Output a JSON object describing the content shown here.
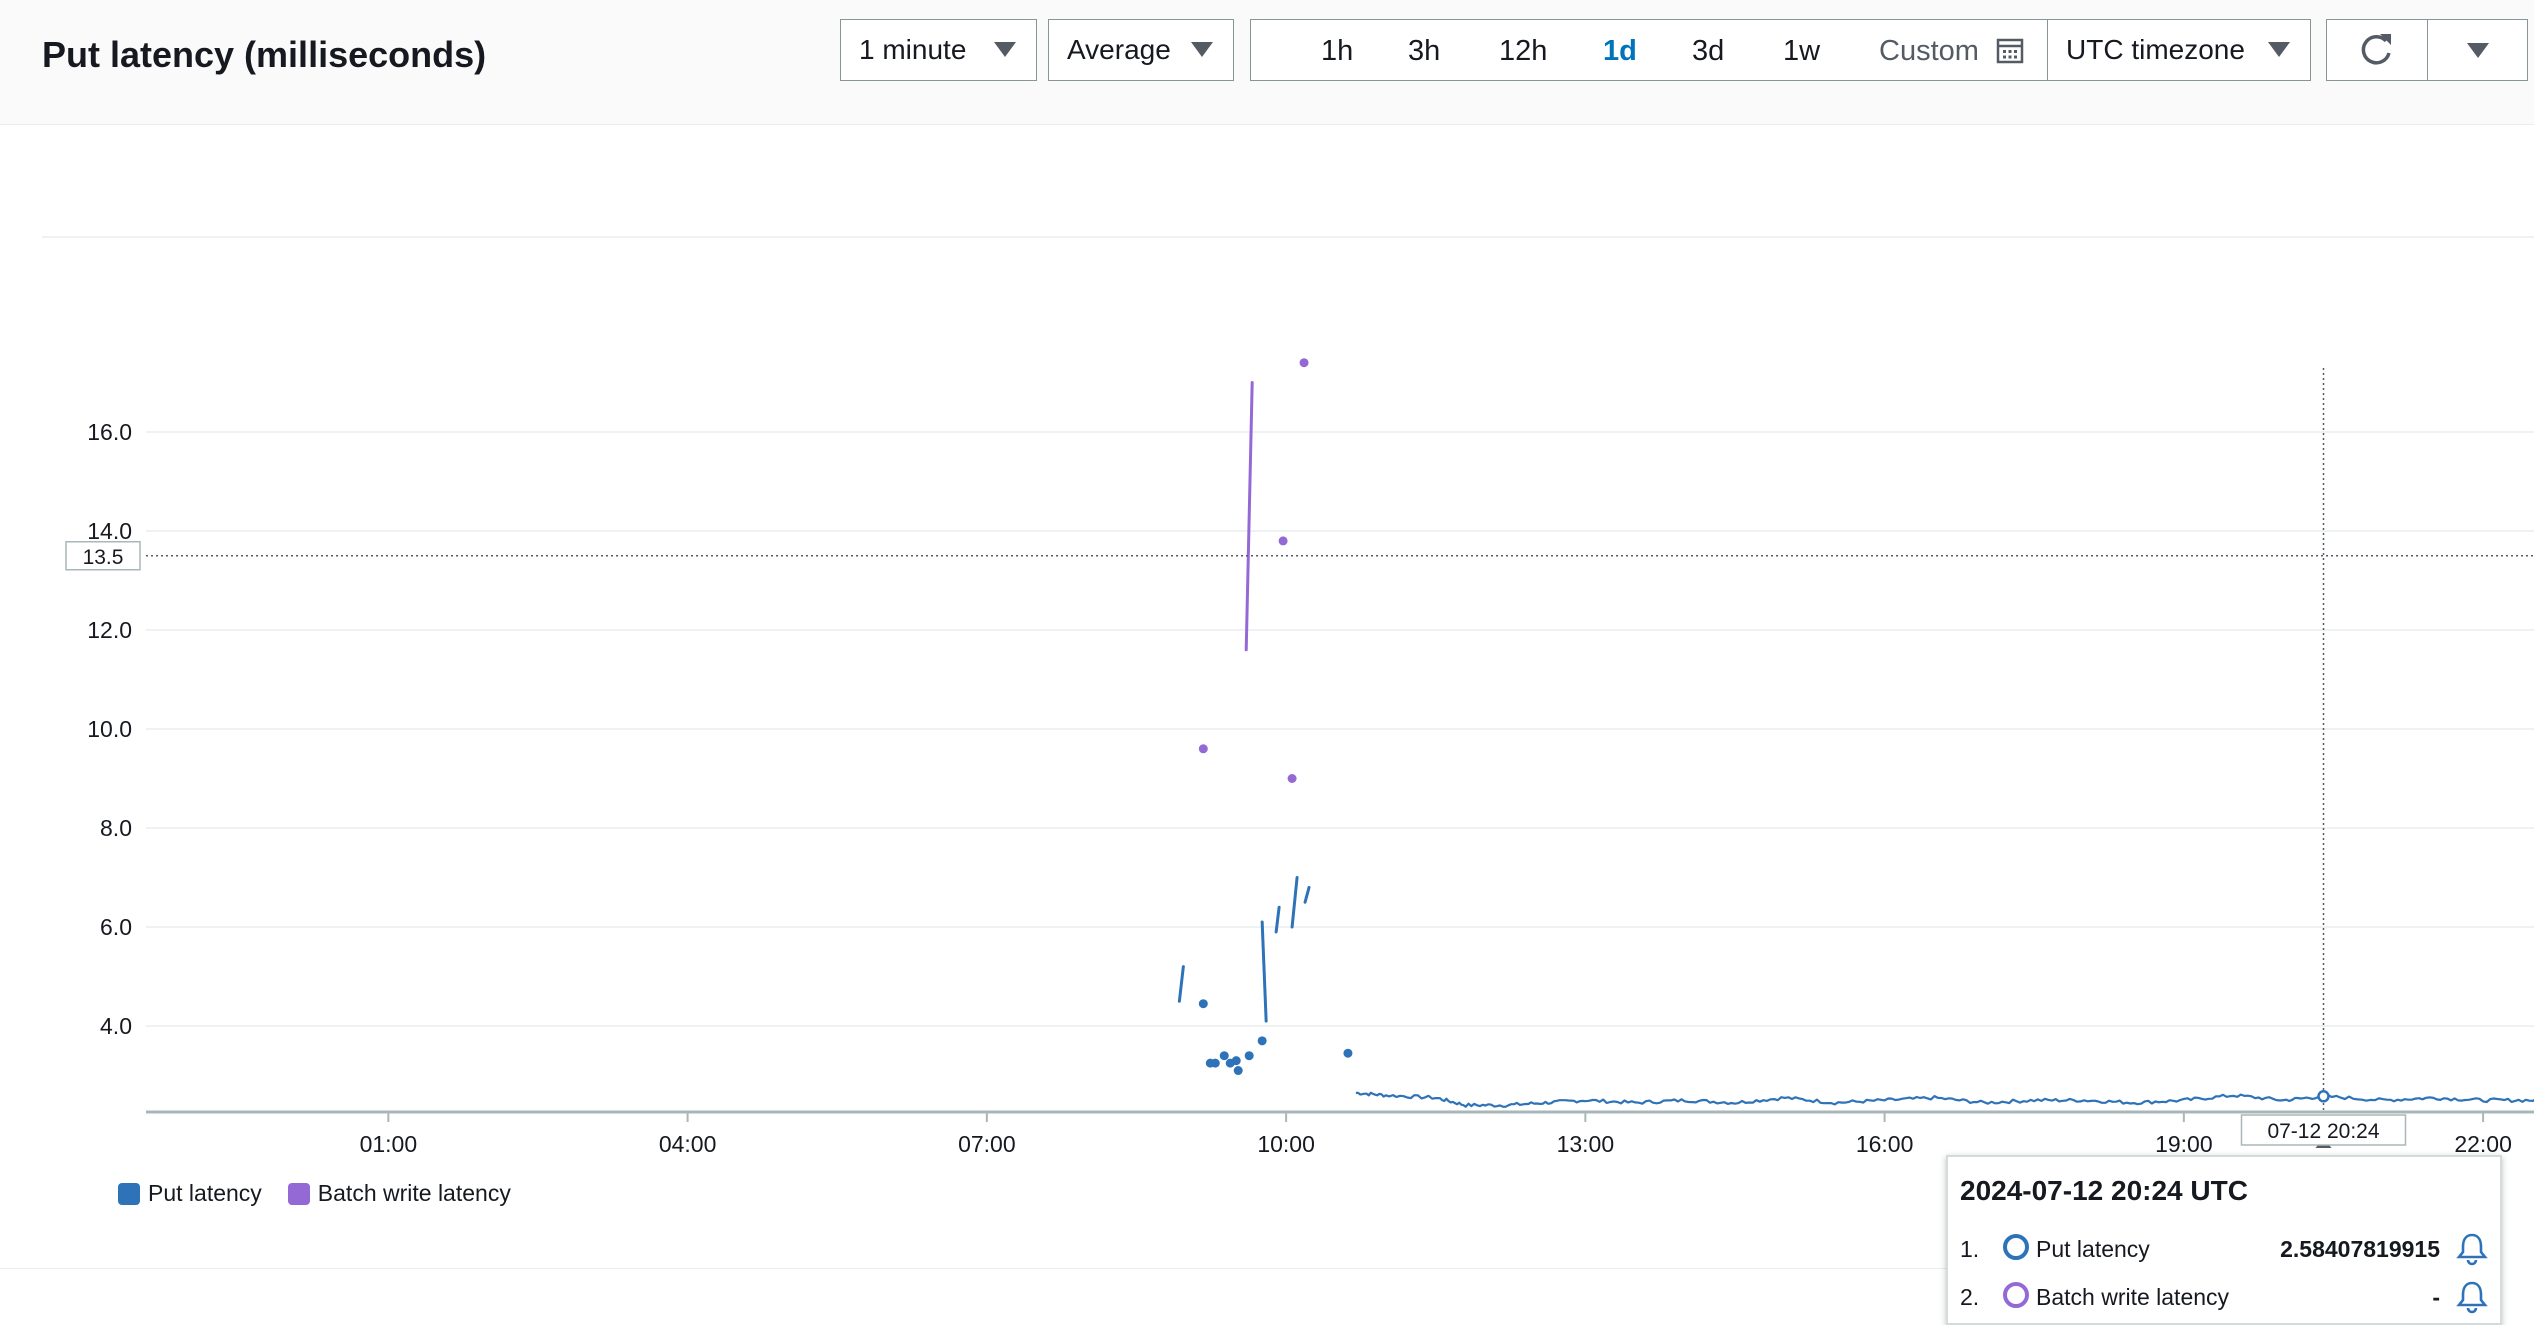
{
  "widget": {
    "title": "Put latency (milliseconds)"
  },
  "toolbar": {
    "period_label": "1 minute",
    "statistic_label": "Average",
    "ranges": [
      "1h",
      "3h",
      "12h",
      "1d",
      "3d",
      "1w"
    ],
    "active_range": "1d",
    "custom_label": "Custom",
    "timezone_label": "UTC timezone"
  },
  "colors": {
    "put_latency": "#2e73b8",
    "batch_write_latency": "#9469d6",
    "active_range": "#0073bb"
  },
  "chart_data": {
    "type": "line",
    "title": "Put latency (milliseconds)",
    "x_tick_labels": [
      "01:00",
      "04:00",
      "07:00",
      "10:00",
      "13:00",
      "16:00",
      "19:00",
      "22:00"
    ],
    "y_tick_labels": [
      "4.0",
      "6.0",
      "8.0",
      "10.0",
      "12.0",
      "14.0",
      "16.0"
    ],
    "x_range_hours": [
      -0.2,
      23.5
    ],
    "ylim": [
      2.35,
      17.5
    ],
    "grid": true,
    "legend_position": "bottom-left",
    "crosshair": {
      "x_label": "07-12 20:24",
      "y_label": "13.5",
      "x_hours": 20.4,
      "y": 13.5
    },
    "series": [
      {
        "name": "Put latency",
        "color": "#2e73b8",
        "segments": [
          [
            [
              8.93,
              4.5
            ],
            [
              8.97,
              5.2
            ]
          ],
          [
            [
              9.8,
              4.1
            ],
            [
              9.76,
              6.1
            ]
          ],
          [
            [
              9.9,
              5.9
            ],
            [
              9.93,
              6.4
            ]
          ],
          [
            [
              10.06,
              6.0
            ],
            [
              10.11,
              7.0
            ]
          ],
          [
            [
              10.19,
              6.5
            ],
            [
              10.23,
              6.8
            ]
          ]
        ],
        "points": [
          [
            9.17,
            4.45
          ],
          [
            9.24,
            3.25
          ],
          [
            9.29,
            3.25
          ],
          [
            9.38,
            3.4
          ],
          [
            9.44,
            3.25
          ],
          [
            9.5,
            3.3
          ],
          [
            9.52,
            3.1
          ],
          [
            9.63,
            3.4
          ],
          [
            9.76,
            3.7
          ],
          [
            10.62,
            3.45
          ]
        ],
        "line_start_hours": 10.7,
        "line_end_hours": 23.5,
        "line_samples": [
          [
            10.7,
            2.65
          ],
          [
            11.0,
            2.6
          ],
          [
            11.5,
            2.55
          ],
          [
            11.8,
            2.4
          ],
          [
            12.2,
            2.4
          ],
          [
            12.6,
            2.45
          ],
          [
            13.0,
            2.5
          ],
          [
            13.5,
            2.45
          ],
          [
            14.0,
            2.5
          ],
          [
            14.5,
            2.45
          ],
          [
            15.0,
            2.55
          ],
          [
            15.5,
            2.45
          ],
          [
            16.0,
            2.5
          ],
          [
            16.5,
            2.55
          ],
          [
            17.0,
            2.45
          ],
          [
            17.5,
            2.5
          ],
          [
            18.0,
            2.5
          ],
          [
            18.5,
            2.45
          ],
          [
            19.0,
            2.5
          ],
          [
            19.5,
            2.6
          ],
          [
            20.0,
            2.5
          ],
          [
            20.4,
            2.58
          ],
          [
            21.0,
            2.5
          ],
          [
            21.5,
            2.55
          ],
          [
            22.0,
            2.5
          ],
          [
            22.5,
            2.5
          ],
          [
            23.0,
            2.55
          ],
          [
            23.5,
            2.6
          ]
        ]
      },
      {
        "name": "Batch write latency",
        "color": "#9469d6",
        "segments": [
          [
            [
              9.6,
              11.6
            ],
            [
              9.66,
              17.0
            ]
          ]
        ],
        "points": [
          [
            9.17,
            9.6
          ],
          [
            9.97,
            13.8
          ],
          [
            10.06,
            9.0
          ],
          [
            10.18,
            17.4
          ]
        ]
      }
    ]
  },
  "legend": {
    "items": [
      "Put latency",
      "Batch write latency"
    ]
  },
  "tooltip": {
    "title": "2024-07-12 20:24 UTC",
    "rows": [
      {
        "index": "1.",
        "label": "Put latency",
        "value": "2.58407819915"
      },
      {
        "index": "2.",
        "label": "Batch write latency",
        "value": "-"
      }
    ]
  }
}
